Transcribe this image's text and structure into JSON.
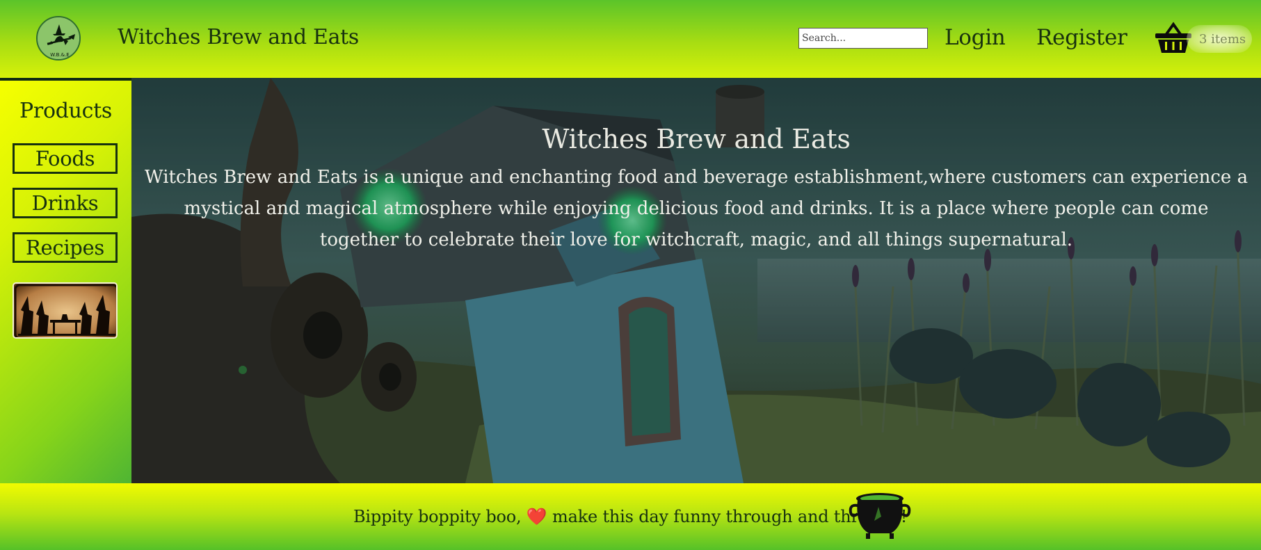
{
  "header": {
    "site_title": "Witches Brew and Eats",
    "logo_text": "W.B.&.E",
    "search_placeholder": "Search...",
    "login_label": "Login",
    "register_label": "Register",
    "cart_count": "3 items",
    "cart_icon": "basket-icon"
  },
  "sidebar": {
    "heading": "Products",
    "items": [
      {
        "label": "Foods"
      },
      {
        "label": "Drinks"
      },
      {
        "label": "Recipes"
      }
    ],
    "image": "witches-tea-party-silhouette"
  },
  "hero": {
    "title": "Witches Brew and Eats",
    "description": "Witches Brew and Eats is a unique and enchanting food and beverage establishment,where customers can experience a mystical and magical atmosphere while enjoying delicious food and drinks. It is a place where people can come together to celebrate their love for witchcraft, magic, and all things supernatural.",
    "background": "witch-cottage-swamp-illustration"
  },
  "footer": {
    "text_before": "Bippity boppity boo, ",
    "heart": "❤️",
    "text_after": " make this day funny through and through!",
    "icon": "cauldron-icon"
  },
  "colors": {
    "header_green": "#5bc42a",
    "header_yellow": "#d6f20a",
    "text_dark": "#17310f",
    "heart_red": "#e12727"
  }
}
